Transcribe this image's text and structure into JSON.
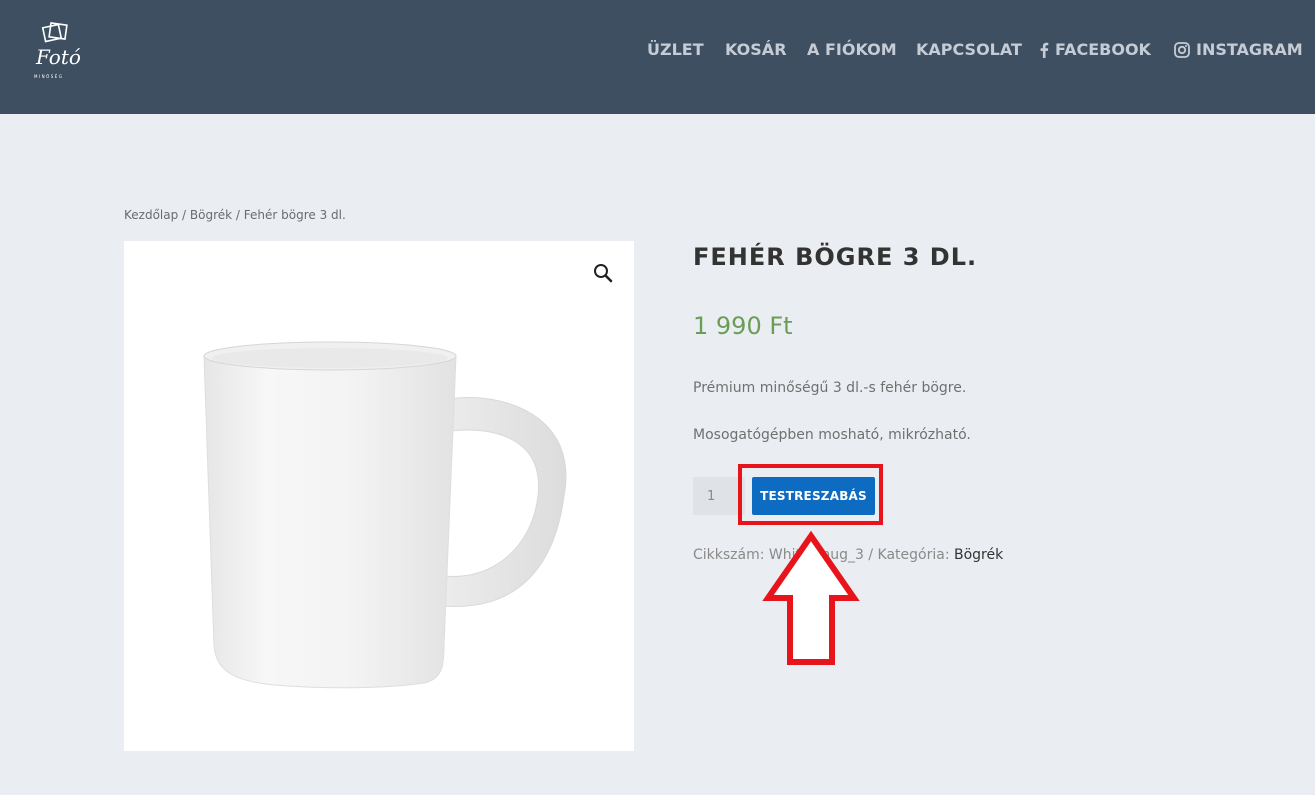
{
  "header": {
    "logo_text": "Fotó",
    "logo_sub": "MINŐSÉG",
    "nav": {
      "uzlet": "ÜZLET",
      "kosar": "KOSÁR",
      "fiokom": "A FIÓKOM",
      "kapcsolat": "KAPCSOLAT",
      "facebook": "FACEBOOK",
      "instagram": "INSTAGRAM"
    }
  },
  "breadcrumb": {
    "home": "Kezdőlap",
    "sep1": " / ",
    "category": "Bögrék",
    "sep2": " / ",
    "current": "Fehér bögre 3 dl."
  },
  "product": {
    "title": "FEHÉR BÖGRE 3 DL.",
    "price": "1 990 Ft",
    "description_1": "Prémium minőségű 3 dl.-s fehér bögre.",
    "description_2": "Mosogatógépben mosható, mikrózható.",
    "quantity": "1",
    "cta_label": "TESTRESZABÁS",
    "meta_prefix": "Cikkszám: White_mug_3 / Kategória: ",
    "meta_category": "Bögrék"
  },
  "colors": {
    "header_bg": "#3e4f62",
    "page_bg": "#eaedf2",
    "price": "#6a9e57",
    "cta": "#0e6bc2",
    "highlight": "#e8141c"
  },
  "icons": {
    "zoom": "magnifier-icon",
    "facebook": "facebook-icon",
    "instagram": "instagram-icon",
    "annotation": "up-arrow-annotation"
  }
}
